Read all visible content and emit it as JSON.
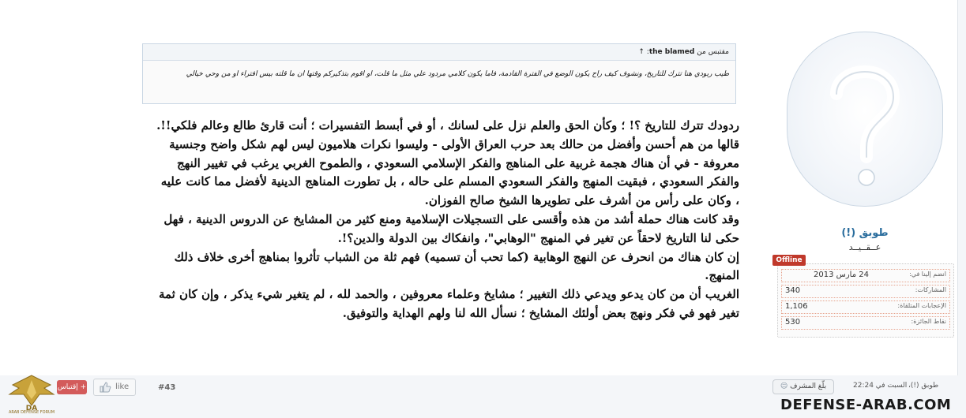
{
  "quote": {
    "header_prefix": "مقتبس من",
    "quoted_user": "the blamed",
    "link_icon": "arrow-up-icon",
    "text": "طيب ربودي هنا تترك للتاريخ، ونشوف كيف راح يكون الوضع في الفترة القادمة، فاما يكون كلامي مردود علي مثل ما قلت، او اقوم بتذكيركم وقتها ان ما قلته بيس افتراء او من وحي خيالي"
  },
  "post": {
    "paragraphs": [
      "ردودك تترك للتاريخ ؟! ؛ وكأن الحق والعلم نزل على لسانك ، أو في أبسط التفسيرات ؛ أنت قارئ طالع وعالم فلكي!!.",
      "قالها من هم أحسن وأفضل من حالك بعد حرب العراق الأولى - وليسوا نكرات هلاميون ليس لهم شكل واضح وجنسية معروفة - في أن هناك هجمة غربية على المناهج والفكر الإسلامي السعودي ، والطموح الغربي يرغب في تغيير النهج والفكر السعودي ، فبقيت المنهج والفكر السعودي المسلم على حاله ، بل تطورت المناهج الدينية لأفضل مما كانت عليه ، وكان على رأس من أشرف على تطويرها الشيخ صالح الفوزان.",
      "وقد كانت هناك حملة أشد من هذه وأقسى على التسجيلات الإسلامية ومنع كثير من المشايخ عن الدروس الدينية ، فهل حكى لنا التاريخ لاحقاً عن تغير في المنهج \"الوهابي\"، وانفكاك بين الدولة والدين؟!.",
      "إن كان هناك من انحرف عن النهج الوهابية (كما تحب أن تسميه) فهم ثلة من الشباب تأثروا بمناهج أخرى خلاف ذلك المنهج.",
      "الغريب أن من كان يدعو ويدعي ذلك التغيير ؛ مشايخ وعلماء معروفين ، والحمد لله ، لم يتغير شيء يذكر ، وإن كان ثمة تغير فهو في فكر ونهج بعض أولئك المشايخ ؛ نسأل الله لنا ولهم الهداية والتوفيق."
    ]
  },
  "user": {
    "avatar_icon": "question-mark-avatar-icon",
    "name": "طوبق (!)",
    "title": "عــقــيــد",
    "status": "Offline",
    "status_color": "#c0392b",
    "stats": [
      {
        "label": "انضم إلينا في:",
        "value": "24 مارس 2013"
      },
      {
        "label": "المشاركات:",
        "value": "340"
      },
      {
        "label": "الإعجابات المتلقاة:",
        "value": "1,106"
      },
      {
        "label": "نقاط الجائزة:",
        "value": "530"
      }
    ]
  },
  "footer": {
    "user": "طوبق (!)،",
    "date": "السبت في 22:24",
    "report_label": "بلّغ المشرف",
    "report_icon": "user-report-icon",
    "post_number": "#43",
    "like_label": "like",
    "like_icon": "thumbs-up-icon",
    "thanks_label": "+ إقتباس",
    "logo_text": "ARAB DEFENSE FORUM",
    "watermark": "DEFENSE-ARAB.COM",
    "accent_color": "#2a6d9d"
  }
}
